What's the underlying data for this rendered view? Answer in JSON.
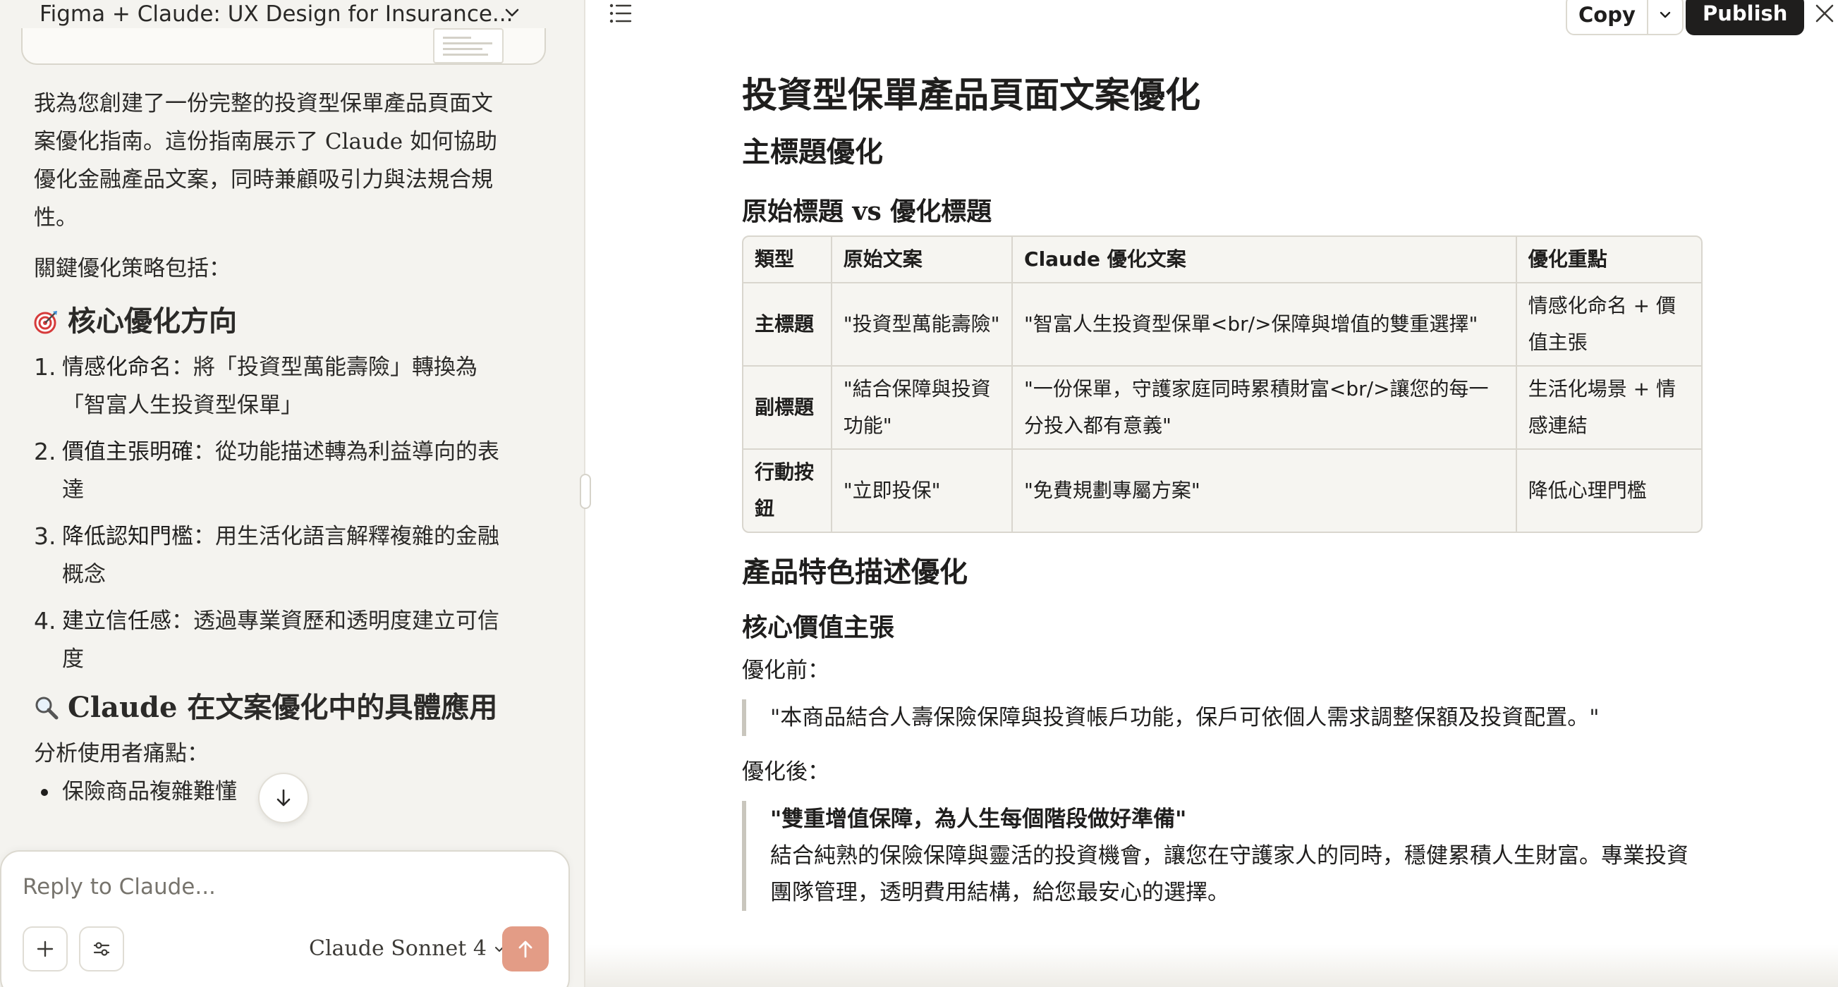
{
  "conversation": {
    "title": "Figma + Claude: UX Design for Insurance..."
  },
  "chat": {
    "intro": "我為您創建了一份完整的投資型保單產品頁面文案優化指南。這份指南展示了 Claude 如何協助優化金融產品文案，同時兼顧吸引力與法規合規性。",
    "strategy_lead": "關鍵優化策略包括：",
    "section1": {
      "icon": "target-icon",
      "title": "核心優化方向"
    },
    "directions": [
      {
        "num": "1.",
        "bold": "情感化命名",
        "text": "：將「投資型萬能壽險」轉換為「智富人生投資型保單」"
      },
      {
        "num": "2.",
        "bold": "價值主張明確",
        "text": "：從功能描述轉為利益導向的表達"
      },
      {
        "num": "3.",
        "bold": "降低認知門檻",
        "text": "：用生活化語言解釋複雜的金融概念"
      },
      {
        "num": "4.",
        "bold": "建立信任感",
        "text": "：透過專業資歷和透明度建立可信度"
      }
    ],
    "section2": {
      "icon": "magnifier-icon",
      "title": "Claude 在文案優化中的具體應用"
    },
    "pain_lead": "分析使用者痛點：",
    "pain_points": [
      "保險商品複雜難懂"
    ]
  },
  "composer": {
    "placeholder": "Reply to Claude...",
    "model": "Claude Sonnet 4"
  },
  "toolbar": {
    "copy_label": "Copy",
    "publish_label": "Publish"
  },
  "doc": {
    "title": "投資型保單產品頁面文案優化",
    "h2_headline": "主標題優化",
    "h3_compare": "原始標題 vs 優化標題",
    "table": {
      "headers": [
        "類型",
        "原始文案",
        "Claude 優化文案",
        "優化重點"
      ],
      "rows": [
        [
          "主標題",
          "\"投資型萬能壽險\"",
          "\"智富人生投資型保單<br/>保障與增值的雙重選擇\"",
          "情感化命名 + 價值主張"
        ],
        [
          "副標題",
          "\"結合保障與投資功能\"",
          "\"一份保單，守護家庭同時累積財富<br/>讓您的每一分投入都有意義\"",
          "生活化場景 + 情感連結"
        ],
        [
          "行動按鈕",
          "\"立即投保\"",
          "\"免費規劃專屬方案\"",
          "降低心理門檻"
        ]
      ]
    },
    "h2_features": "產品特色描述優化",
    "h3_value": "核心價值主張",
    "before_label": "優化前：",
    "before_quote": "\"本商品結合人壽保險保障與投資帳戶功能，保戶可依個人需求調整保額及投資配置。\"",
    "after_label": "優化後：",
    "after_quote_title": "\"雙重增值保障，為人生每個階段做好準備\"",
    "after_quote_body": "結合純熟的保險保障與靈活的投資機會，讓您在守護家人的同時，穩健累積人生財富。專業投資團隊管理，透明費用結構，給您最安心的選擇。"
  }
}
